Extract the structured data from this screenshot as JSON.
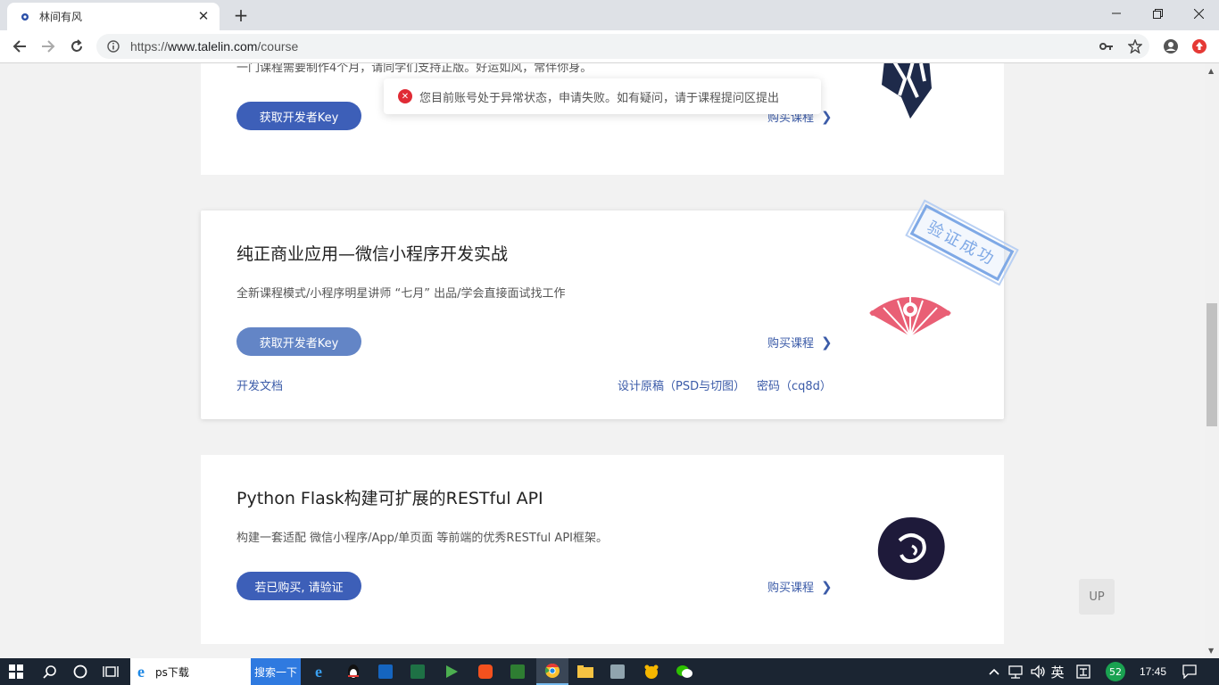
{
  "browser": {
    "tab_title": "林间有风",
    "url_prefix": "https://",
    "url_domain": "www.talelin.com",
    "url_path": "/course",
    "new_tab_label": "+",
    "close_tab_label": "✕"
  },
  "toast": {
    "message": "您目前账号处于异常状态，申请失败。如有疑问，请于课程提问区提出",
    "icon": "error-icon"
  },
  "courses": [
    {
      "desc": "一门课程需要制作4个月，请同学们支持正版。好运如风，常伴你身。",
      "button": "获取开发者Key",
      "buy": "购买课程"
    },
    {
      "title": "纯正商业应用—微信小程序开发实战",
      "desc": "全新课程模式/小程序明星讲师 “七月” 出品/学会直接面试找工作",
      "button": "获取开发者Key",
      "buy": "购买课程",
      "doc_link": "开发文档",
      "design_link": "设计原稿（PSD与切图）",
      "password_link": "密码（cq8d）",
      "stamp": "验证成功"
    },
    {
      "title": "Python Flask构建可扩展的RESTful API",
      "desc": "构建一套适配 微信小程序/App/单页面 等前端的优秀RESTful API框架。",
      "button": "若已购买, 请验证",
      "buy": "购买课程"
    }
  ],
  "up_button": "UP",
  "taskbar": {
    "search_text": "ps下载",
    "search_button": "搜索一下",
    "ime": "英",
    "badge": "52",
    "time": "17:45"
  },
  "colors": {
    "primary_button": "#3d5fb8",
    "active_button": "#6385c6",
    "link": "#3b5ba8",
    "stamp": "#7fa9e6",
    "error": "#e02b35",
    "logo_dark": "#1e2a4a",
    "logo_pink": "#e95f75"
  }
}
